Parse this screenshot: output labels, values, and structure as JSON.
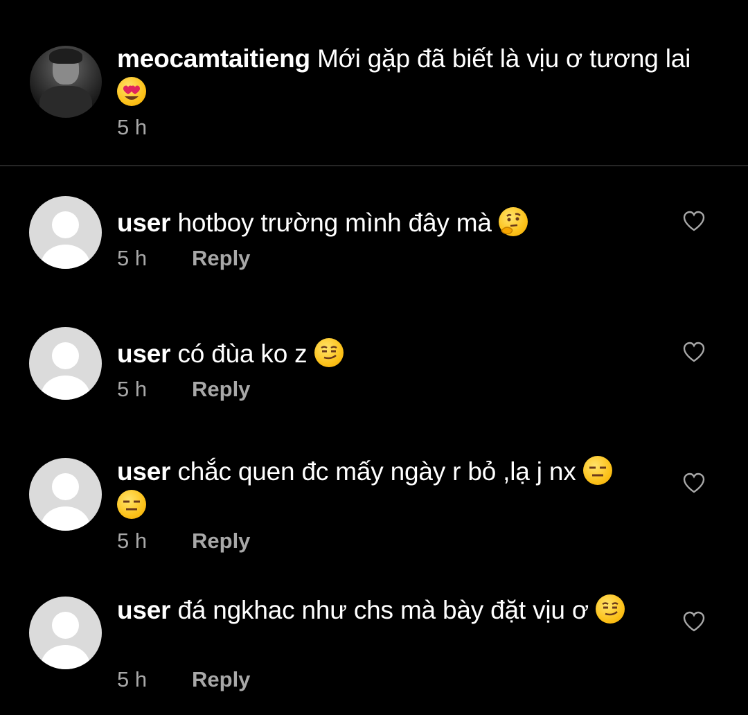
{
  "caption": {
    "username": "meocamtaitieng",
    "text": "Mới gặp đã biết là vịu ơ tương lai",
    "emoji": "heart-eyes-emoji",
    "time": "5 h"
  },
  "comments": [
    {
      "username": "user",
      "text": "hotboy trường mình đây mà",
      "emojis": [
        "thinking-face-emoji"
      ],
      "time": "5 h",
      "reply_label": "Reply"
    },
    {
      "username": "user",
      "text": "có đùa ko z",
      "emojis": [
        "smirking-face-emoji"
      ],
      "time": "5 h",
      "reply_label": "Reply"
    },
    {
      "username": "user",
      "text": "chắc quen đc mấy ngày r bỏ ,lạ j nx",
      "emojis": [
        "expressionless-face-emoji",
        "expressionless-face-emoji"
      ],
      "time": "5 h",
      "reply_label": "Reply"
    },
    {
      "username": "user",
      "text": "đá ngkhac như chs mà bày đặt vịu ơ",
      "emojis": [
        "smirking-face-emoji"
      ],
      "time": "5 h",
      "reply_label": "Reply"
    }
  ],
  "colors": {
    "background": "#000000",
    "text": "#ffffff",
    "secondary_text": "#a8a8a8",
    "divider": "#262626",
    "placeholder_avatar": "#dbdbdb"
  }
}
